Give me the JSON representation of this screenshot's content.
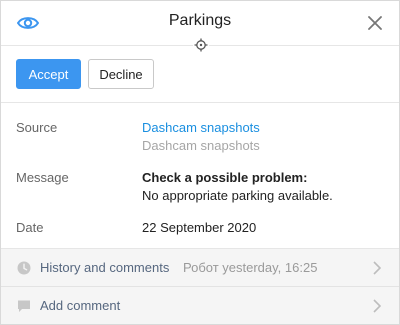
{
  "header": {
    "title": "Parkings",
    "eye_icon": "eye-icon",
    "close_icon": "close-icon",
    "target_icon": "crosshair-icon"
  },
  "actions": {
    "accept_label": "Accept",
    "decline_label": "Decline"
  },
  "details": {
    "source_label": "Source",
    "source_link": "Dashcam snapshots",
    "source_sub": "Dashcam snapshots",
    "message_label": "Message",
    "message_title": "Check a possible problem:",
    "message_body": "No appropriate parking available.",
    "date_label": "Date",
    "date_value": "22 September 2020"
  },
  "history": {
    "label": "History and comments",
    "meta": "Робот yesterday, 16:25",
    "icon": "clock-icon"
  },
  "comment": {
    "label": "Add comment",
    "icon": "comment-icon"
  },
  "colors": {
    "accent": "#3c96f0",
    "link": "#1a8fe0",
    "muted": "#a6a6a6",
    "row_bg": "#f5f5f5"
  }
}
